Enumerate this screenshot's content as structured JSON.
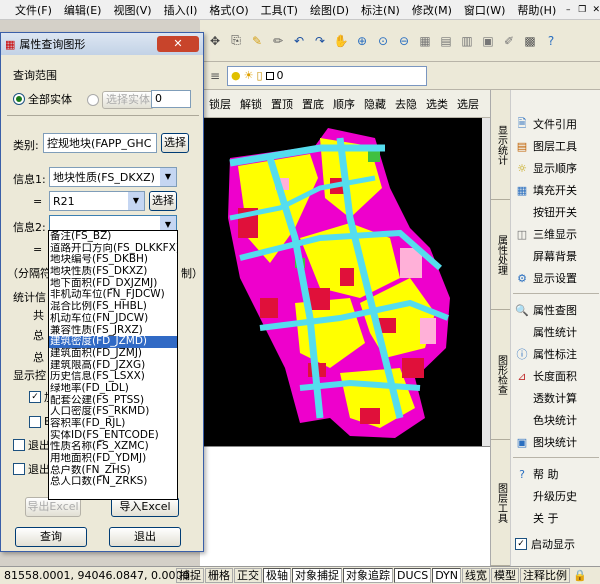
{
  "menu": {
    "items": [
      "文件(F)",
      "编辑(E)",
      "视图(V)",
      "插入(I)",
      "格式(O)",
      "工具(T)",
      "绘图(D)",
      "标注(N)",
      "修改(M)",
      "窗口(W)"
    ],
    "help": "帮助(H)"
  },
  "toolbar": {
    "layer_value": "0",
    "commands": [
      "锁层",
      "解锁",
      "置顶",
      "置底",
      "顺序",
      "隐藏",
      "去隐",
      "选类",
      "选层"
    ]
  },
  "side_tabs": [
    "显示统计",
    "属性处理",
    "图形检查",
    "图层工具"
  ],
  "right_panel": [
    {
      "label": "文件引用",
      "icon": "file-reference-icon"
    },
    {
      "label": "图层工具",
      "icon": "layer-tool-icon"
    },
    {
      "label": "显示顺序",
      "icon": "display-order-icon"
    },
    {
      "label": "填充开关",
      "icon": "fill-toggle-icon"
    },
    {
      "label": "按钮开关",
      "icon": ""
    },
    {
      "label": "三维显示",
      "icon": "3d-display-icon"
    },
    {
      "label": "屏幕背景",
      "icon": ""
    },
    {
      "label": "显示设置",
      "icon": "display-settings-icon"
    },
    {
      "label": "属性查图",
      "icon": "search-icon"
    },
    {
      "label": "属性统计",
      "icon": ""
    },
    {
      "label": "属性标注",
      "icon": "info-icon"
    },
    {
      "label": "长度面积",
      "icon": "measure-icon"
    },
    {
      "label": "透数计算",
      "icon": ""
    },
    {
      "label": "色块统计",
      "icon": ""
    },
    {
      "label": "图块统计",
      "icon": "block-stat-icon"
    },
    {
      "label": "帮      助",
      "icon": "help-icon"
    },
    {
      "label": "升级历史",
      "icon": ""
    },
    {
      "label": "关      于",
      "icon": ""
    },
    {
      "label": "启动显示",
      "icon": "checkbox-icon"
    }
  ],
  "status": {
    "coords": "81558.0001, 94046.0847, 0.0000",
    "toggles": [
      "捕捉",
      "栅格",
      "正交",
      "极轴",
      "对象捕捉",
      "对象追踪",
      "DUCS",
      "DYN",
      "线宽",
      "模型",
      "注释比例"
    ],
    "on": [
      "极轴",
      "对象捕捉",
      "对象追踪",
      "DUCS",
      "DYN"
    ]
  },
  "dialog": {
    "title": "属性查询图形",
    "close": "关闭",
    "query_range_label": "查询范围",
    "all_entities": "全部实体",
    "selected_entities": "选择实体",
    "selected_count": "0",
    "category_label": "类别:",
    "category_value": "控规地块(FAPP_GHC",
    "select_button": "选择",
    "info1_label": "信息1:",
    "info1_value": "地块性质(FS_DKXZ)",
    "eq1": "=",
    "info1_input": "R21",
    "select_button2": "选择",
    "info2_label": "信息2:",
    "eq2": "=",
    "partial_line": "（分隔符",
    "partial_line_end": "制）",
    "stats_label": "统计信",
    "row_a": "共",
    "row_b": "总",
    "row_c": "总",
    "display_label": "显示控",
    "row_d": "加",
    "row_e": "B",
    "exit_a": "退出",
    "exit_b": "退出",
    "export_excel": "导出Excel",
    "import_excel": "导入Excel",
    "query_button": "查询",
    "exit_button": "退出"
  },
  "dropdown": {
    "items": [
      "备注(FS_BZ)",
      "道路开口方向(FS_DLKKFX)",
      "地块编号(FS_DKBH)",
      "地块性质(FS_DKXZ)",
      "地下面积(FD_DXJZMJ)",
      "非机动车位(FN_FJDCW)",
      "混合比例(FS_HHBL)",
      "机动车位(FN_JDCW)",
      "兼容性质(FS_JRXZ)",
      "建筑密度(FD_JZMD)",
      "建筑面积(FD_JZMJ)",
      "建筑限高(FD_JZXG)",
      "历史信息(FS_LSXX)",
      "绿地率(FD_LDL)",
      "配套公建(FS_PTSS)",
      "人口密度(FS_RKMD)",
      "容积率(FD_RJL)",
      "实体ID(FS_ENTCODE)",
      "性质名称(FS_XZMC)",
      "用地面积(FD_YDMJ)",
      "总户数(FN_ZHS)",
      "总人口数(FN_ZRKS)"
    ],
    "selected_index": 9
  }
}
